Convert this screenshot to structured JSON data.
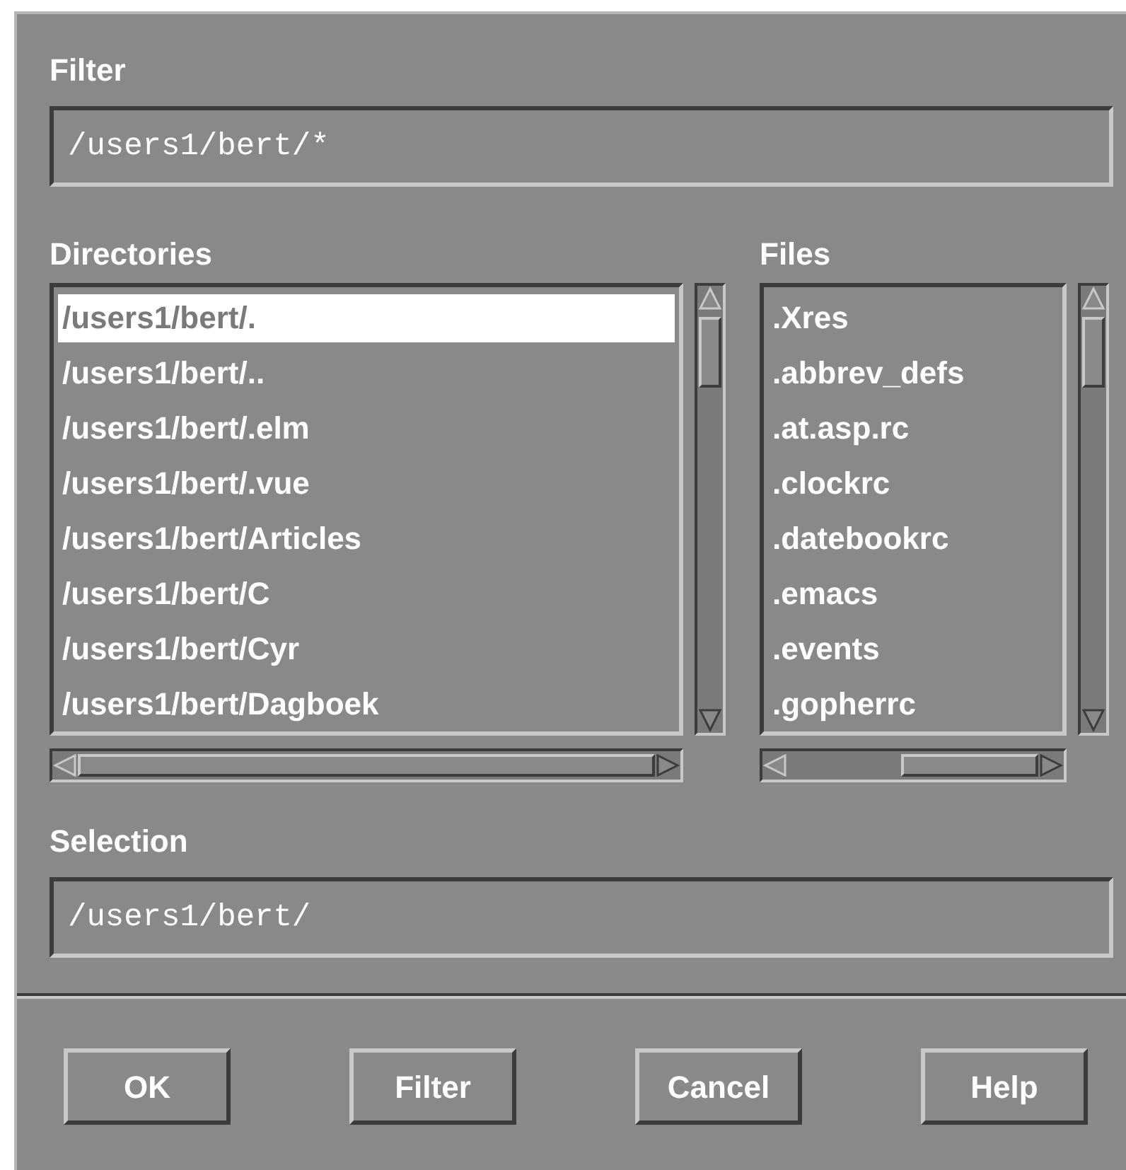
{
  "filter": {
    "label": "Filter",
    "value": "/users1/bert/*"
  },
  "directories": {
    "label": "Directories",
    "items": [
      {
        "text": "/users1/bert/.",
        "selected": true
      },
      {
        "text": "/users1/bert/..",
        "selected": false
      },
      {
        "text": "/users1/bert/.elm",
        "selected": false
      },
      {
        "text": "/users1/bert/.vue",
        "selected": false
      },
      {
        "text": "/users1/bert/Articles",
        "selected": false
      },
      {
        "text": "/users1/bert/C",
        "selected": false
      },
      {
        "text": "/users1/bert/Cyr",
        "selected": false
      },
      {
        "text": "/users1/bert/Dagboek",
        "selected": false
      }
    ]
  },
  "files": {
    "label": "Files",
    "items": [
      {
        "text": ".Xres",
        "selected": false
      },
      {
        "text": ".abbrev_defs",
        "selected": false
      },
      {
        "text": ".at.asp.rc",
        "selected": false
      },
      {
        "text": ".clockrc",
        "selected": false
      },
      {
        "text": ".datebookrc",
        "selected": false
      },
      {
        "text": ".emacs",
        "selected": false
      },
      {
        "text": ".events",
        "selected": false
      },
      {
        "text": ".gopherrc",
        "selected": false
      }
    ]
  },
  "selection": {
    "label": "Selection",
    "value": "/users1/bert/"
  },
  "buttons": [
    "OK",
    "Filter",
    "Cancel",
    "Help"
  ]
}
